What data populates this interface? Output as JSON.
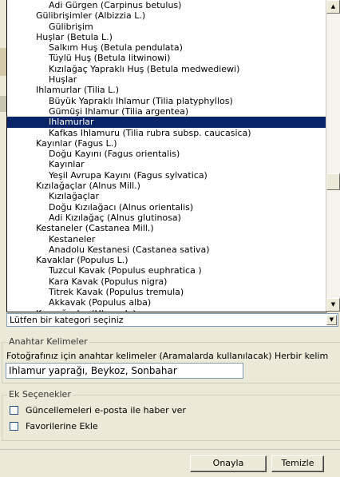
{
  "category_list": {
    "items": [
      {
        "label": "Adi Gürgen (Carpinus betulus)",
        "level": 2
      },
      {
        "label": "Gülibrişimler (Albizzia L.)",
        "level": 1
      },
      {
        "label": "Gülibrişim",
        "level": 2
      },
      {
        "label": "Huşlar (Betula L.)",
        "level": 1
      },
      {
        "label": "Salkım Huş (Betula pendulata)",
        "level": 2
      },
      {
        "label": "Tüylü Huş (Betula litwinowi)",
        "level": 2
      },
      {
        "label": "Kızılağaç Yapraklı Huş (Betula medwediewi)",
        "level": 2
      },
      {
        "label": "Huşlar",
        "level": 2
      },
      {
        "label": "Ihlamurlar (Tilia L.)",
        "level": 1
      },
      {
        "label": "Büyük Yapraklı Ihlamur (Tilia platyphyllos)",
        "level": 2
      },
      {
        "label": "Gümüşi Ihlamur (Tilia argentea)",
        "level": 2
      },
      {
        "label": "Ihlamurlar",
        "level": 2,
        "selected": true
      },
      {
        "label": "Kafkas Ihlamuru (Tilia rubra subsp. caucasica)",
        "level": 2
      },
      {
        "label": "Kayınlar (Fagus L.)",
        "level": 1
      },
      {
        "label": "Doğu Kayını (Fagus orientalis)",
        "level": 2
      },
      {
        "label": "Kayınlar",
        "level": 2
      },
      {
        "label": "Yeşil Avrupa Kayını (Fagus sylvatica)",
        "level": 2
      },
      {
        "label": "Kızılağaçlar (Alnus Mill.)",
        "level": 1
      },
      {
        "label": "Kızılağaçlar",
        "level": 2
      },
      {
        "label": "Doğu Kızılağacı (Alnus orientalis)",
        "level": 2
      },
      {
        "label": "Adi Kızılağaç (Alnus glutinosa)",
        "level": 2
      },
      {
        "label": "Kestaneler (Castanea Mill.)",
        "level": 1
      },
      {
        "label": "Kestaneler",
        "level": 2
      },
      {
        "label": "Anadolu Kestanesi (Castanea sativa)",
        "level": 2
      },
      {
        "label": "Kavaklar (Populus L.)",
        "level": 1
      },
      {
        "label": "Tuzcul Kavak (Populus euphratica )",
        "level": 2
      },
      {
        "label": "Kara Kavak (Populus nigra)",
        "level": 2
      },
      {
        "label": "Titrek Kavak (Populus tremula)",
        "level": 2
      },
      {
        "label": "Akkavak (Populus alba)",
        "level": 2
      },
      {
        "label": "Karaağaçlar (Ulmus L.)",
        "level": 1
      }
    ]
  },
  "category_select": {
    "value": "Lütfen bir kategori seçiniz"
  },
  "keywords": {
    "legend": "Anahtar Kelimeler",
    "description": "Fotoğrafınız için anahtar kelimeler (Aramalarda kullanılacak) Herbir kelim",
    "value": "Ihlamur yaprağı, Beykoz, Sonbahar"
  },
  "options": {
    "legend": "Ek Seçenekler",
    "email_updates_label": "Güncellemeleri e-posta ile haber ver",
    "favorites_label": "Favorilerine Ekle"
  },
  "actions": {
    "confirm_label": "Onayla",
    "clear_label": "Temizle"
  },
  "colors": {
    "selection": "#0a246a",
    "background": "#ece9d8"
  }
}
